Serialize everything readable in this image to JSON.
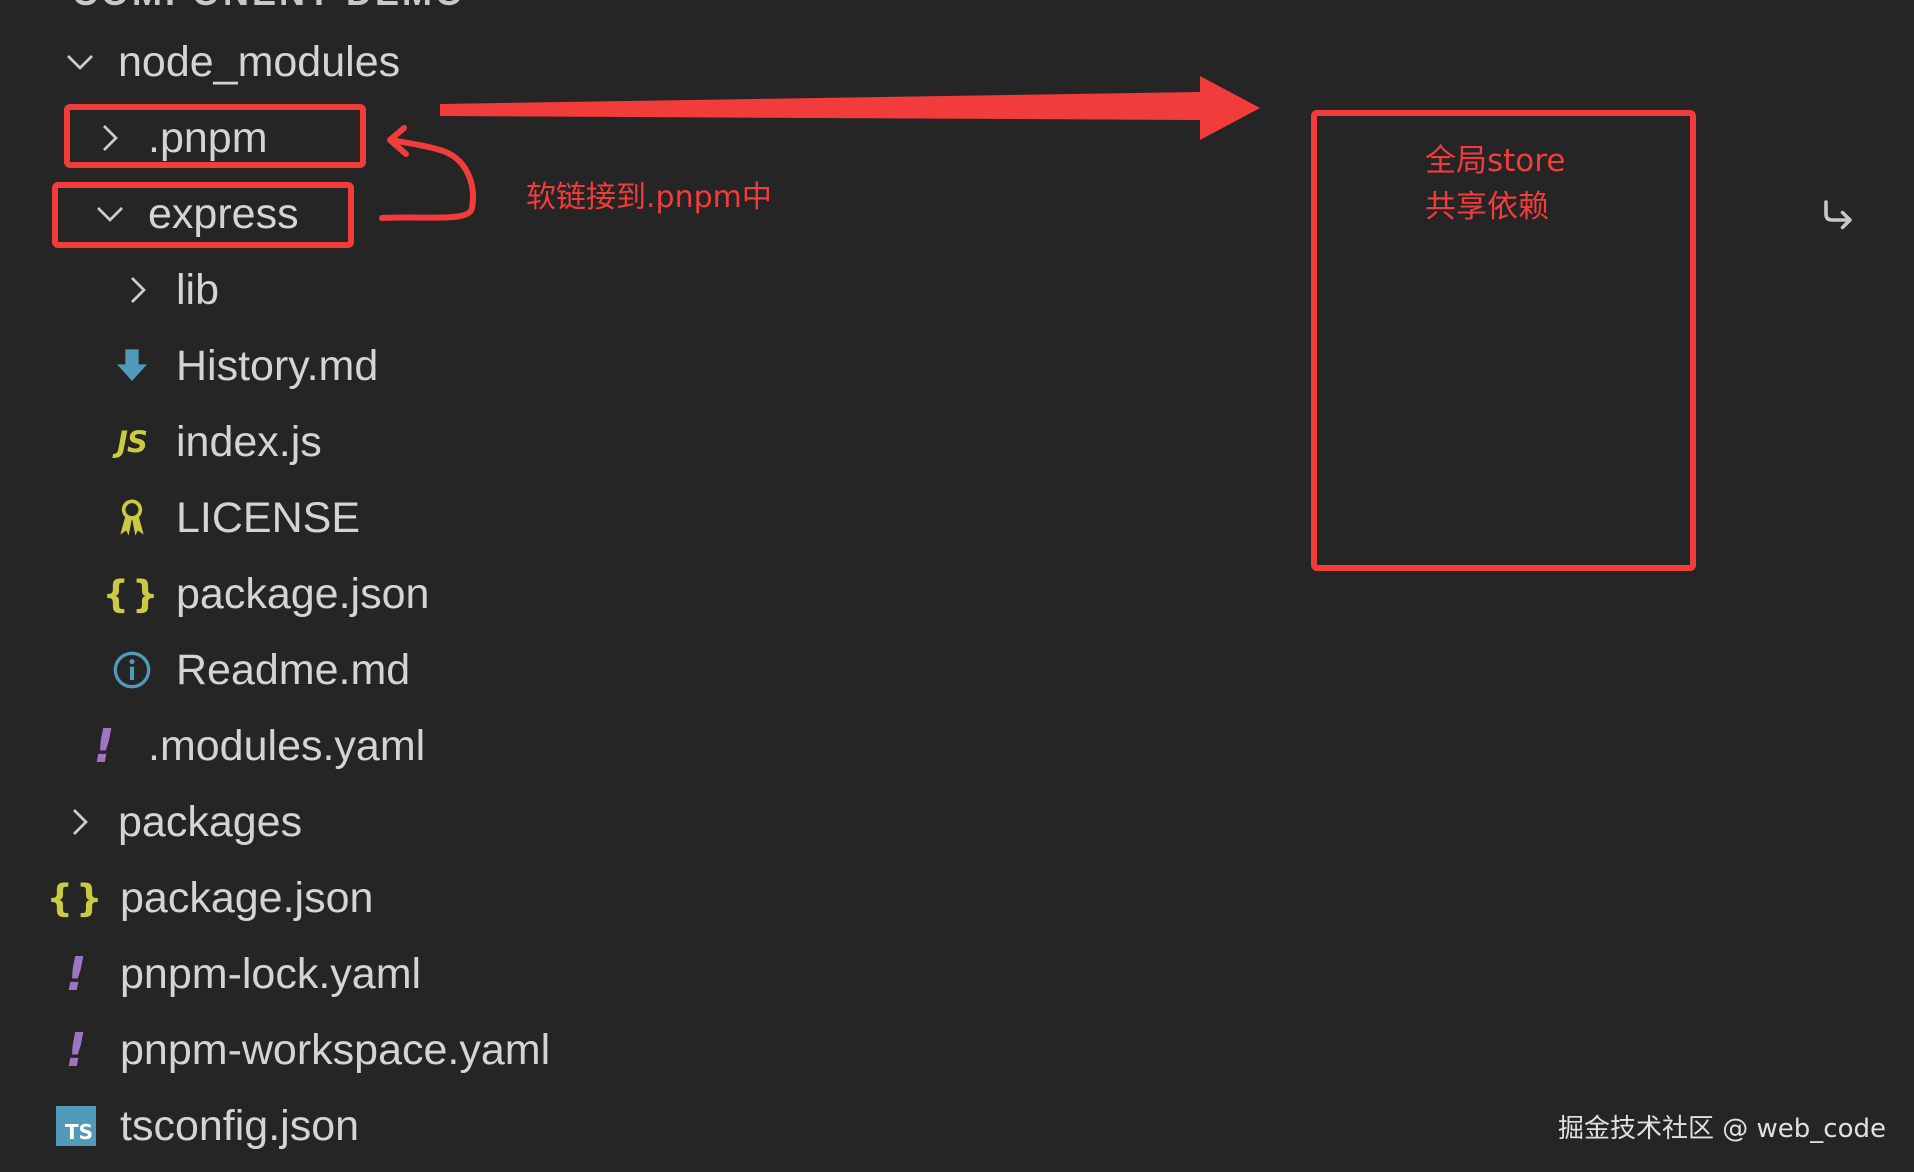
{
  "explorer": {
    "section_title": "COMPONENT-DEMO",
    "items": {
      "node_modules": {
        "label": "node_modules",
        "icon": "chevron-down-icon"
      },
      "pnpm": {
        "label": ".pnpm",
        "icon": "chevron-right-icon"
      },
      "express": {
        "label": "express",
        "icon": "chevron-down-icon"
      },
      "lib": {
        "label": "lib",
        "icon": "chevron-right-icon"
      },
      "history": {
        "label": "History.md",
        "icon": "markdown-download-icon"
      },
      "indexjs": {
        "label": "index.js",
        "icon": "javascript-icon",
        "glyph": "JS"
      },
      "license": {
        "label": "LICENSE",
        "icon": "license-icon"
      },
      "express_package": {
        "label": "package.json",
        "icon": "json-icon",
        "glyph": "{}"
      },
      "readme": {
        "label": "Readme.md",
        "icon": "info-icon"
      },
      "modules_yaml": {
        "label": ".modules.yaml",
        "icon": "yaml-icon",
        "glyph": "!"
      },
      "packages": {
        "label": "packages",
        "icon": "chevron-right-icon"
      },
      "root_package": {
        "label": "package.json",
        "icon": "json-icon",
        "glyph": "{}"
      },
      "lock_yaml": {
        "label": "pnpm-lock.yaml",
        "icon": "yaml-icon",
        "glyph": "!"
      },
      "workspace_yaml": {
        "label": "pnpm-workspace.yaml",
        "icon": "yaml-icon",
        "glyph": "!"
      },
      "tsconfig": {
        "label": "tsconfig.json",
        "icon": "typescript-icon",
        "glyph": "TS"
      }
    }
  },
  "annotations": {
    "symlink_note": "软链接到.pnpm中",
    "store_line1": "全局store",
    "store_line2": "共享依赖",
    "color": "#f23c3c"
  },
  "watermark": "掘金技术社区 @ web_code",
  "colors": {
    "background": "#252526",
    "text": "#d4d4d4",
    "js": "#cbcb41",
    "yaml": "#a074c4",
    "ts": "#519aba",
    "markdown": "#519aba"
  }
}
